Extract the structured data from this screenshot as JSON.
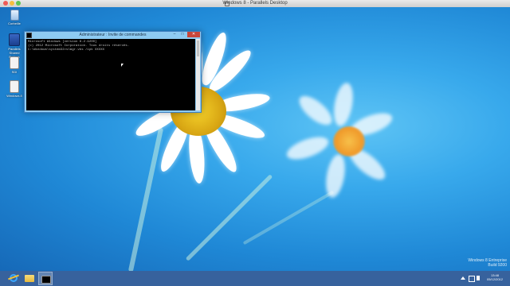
{
  "host": {
    "title": "Windows 8 - Parallels Desktop"
  },
  "desktop_icons": [
    {
      "label": "Corbeille",
      "icon": "recycle-bin-icon"
    },
    {
      "label": "Parallels Shared Folders",
      "icon": "shared-folders-icon"
    },
    {
      "label": "SDI",
      "icon": "document-icon"
    },
    {
      "label": "Windows 8",
      "icon": "document-icon"
    }
  ],
  "cmd": {
    "title": "Administrateur : Invite de commandes",
    "minimize": "–",
    "maximize": "□",
    "close": "✕",
    "lines": [
      "Microsoft Windows [version 6.2.9200]",
      "(c) 2012 Microsoft Corporation. Tous droits réservés.",
      "",
      "C:\\Windows\\system32>slmgr.vbs /ipk XXXXX"
    ]
  },
  "taskbar": {
    "apps": [
      "internet-explorer-icon",
      "file-explorer-icon",
      "command-prompt-icon"
    ],
    "time": "13:48",
    "date": "05/12/2012"
  },
  "watermark": {
    "line1": "Windows 8 Entreprise",
    "line2": "Build 9200"
  },
  "colors": {
    "accent": "#1f88d6",
    "taskbar": "#14468c",
    "cmd_frame": "#8ecbf2"
  }
}
